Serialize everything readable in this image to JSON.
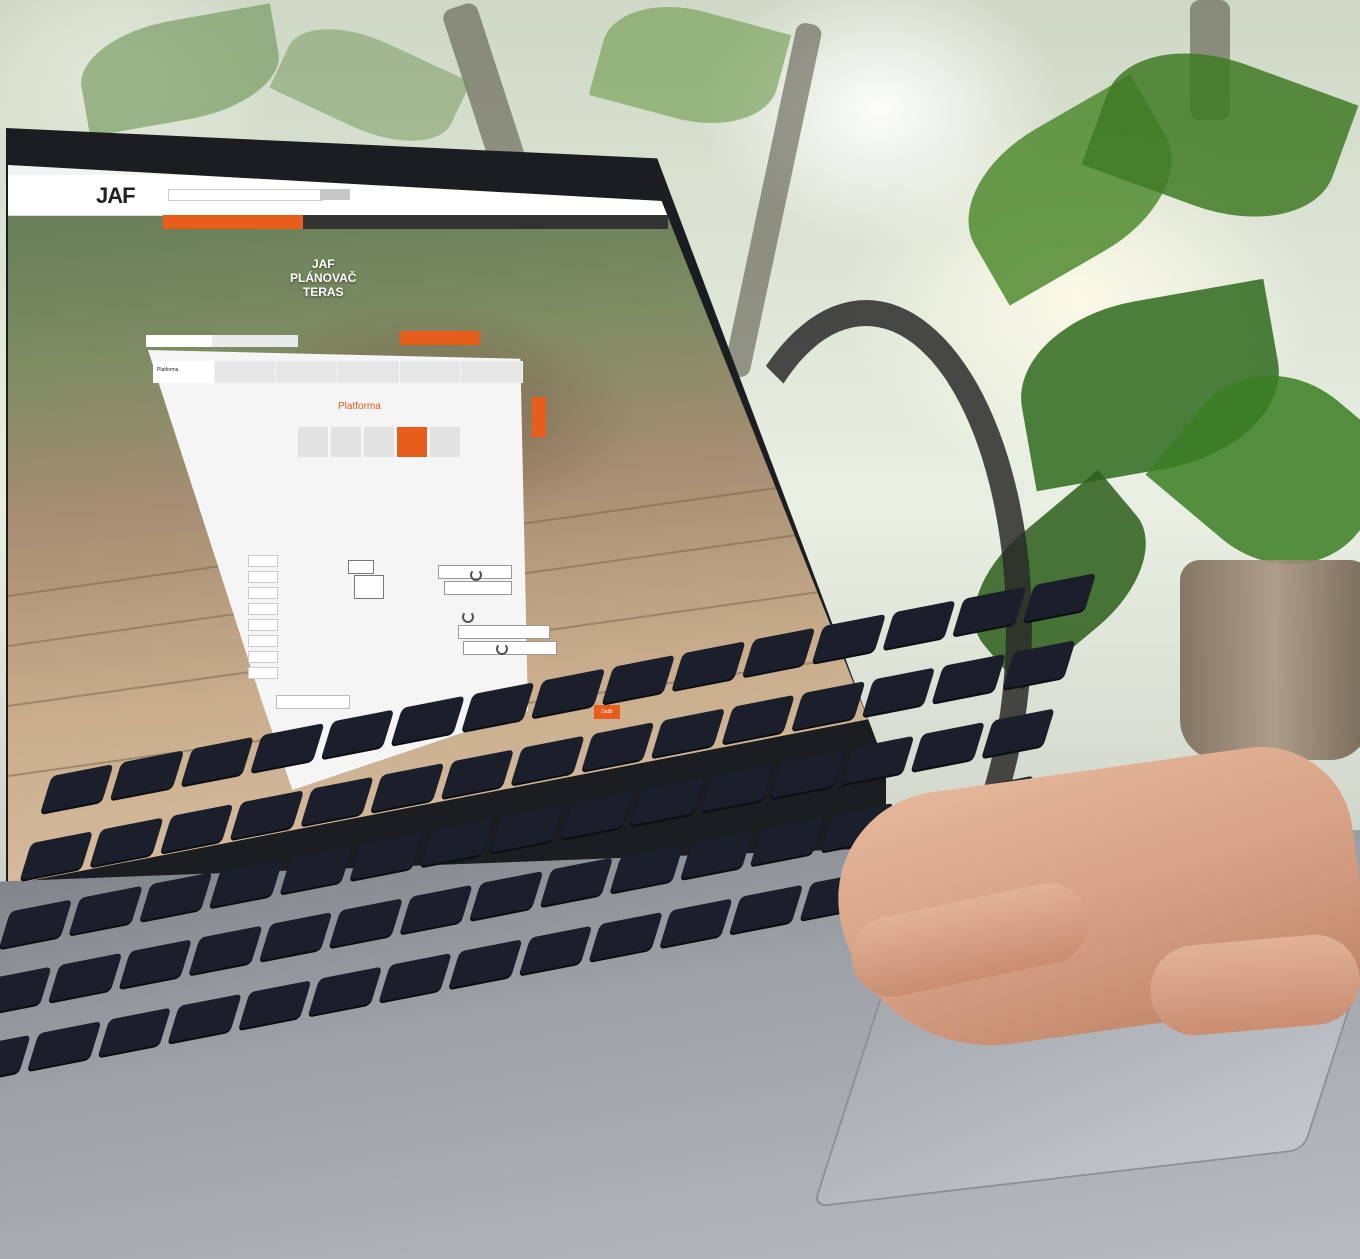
{
  "site": {
    "logo": "JAF",
    "hero_title": "JAF\nPLÁNOVAČ\nTERAS",
    "card_heading": "Platforma",
    "tabs": [
      "Platforma",
      "",
      "",
      "",
      "",
      ""
    ],
    "next_button": "Další"
  },
  "colors": {
    "brand_orange": "#e85d1b",
    "nav_dark": "#333333"
  }
}
